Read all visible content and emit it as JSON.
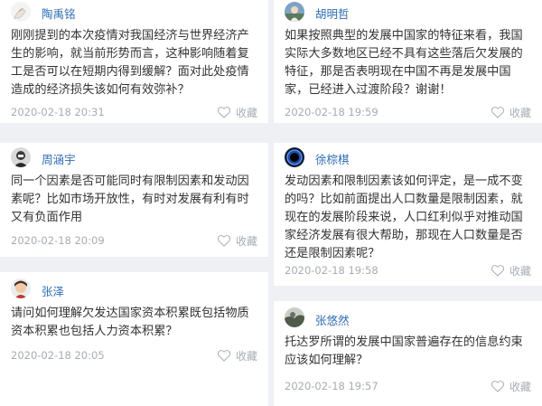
{
  "left_column": [
    {
      "user": "陶禹铭",
      "question": "刚刚提到的本次疫情对我国经济与世界经济产生的影响，就当前形势而言，这种影响随着复工是否可以在短期内得到缓解？面对此处疫情造成的经济损失该如何有效弥补？",
      "date": "2020-02-18 20:31",
      "fav_label": "收藏"
    },
    {
      "user": "周涵宇",
      "question": "同一个因素是否可能同时有限制因素和发动因素呢？比如市场开放性，有时对发展有利有时又有负面作用",
      "date": "2020-02-18 20:09",
      "fav_label": "收藏"
    },
    {
      "user": "张泽",
      "question": "请问如何理解欠发达国家资本积累既包括物质资本积累也包括人力资本积累？",
      "date": "2020-02-18 20:05",
      "fav_label": "收藏"
    }
  ],
  "right_column": [
    {
      "user": "胡明哲",
      "question": "如果按照典型的发展中国家的特征来看，我国实际大多数地区已经不具有这些落后欠发展的特征，那是否表明现在中国不再是发展中国家，已经进入过渡阶段？谢谢！",
      "date": "2020-02-18 19:59",
      "fav_label": "收藏"
    },
    {
      "user": "徐棕棋",
      "question": "发动因素和限制因素该如何评定，是一成不变的吗？比如前面提出人口数量是限制因素，就现在的发展阶段来说，人口红利似乎对推动国家经济发展有很大帮助，那现在人口数量是否还是限制因素呢？",
      "date": "2020-02-18 19:58",
      "fav_label": "收藏"
    },
    {
      "user": "张悠然",
      "question": "托达罗所谓的发展中国家普遍存在的信息约束应该如何理解？",
      "date": "2020-02-18 19:57",
      "fav_label": "收藏"
    }
  ],
  "icons": {
    "favorite": "heart-outline-icon"
  },
  "colors": {
    "username": "#2f6db3",
    "question_text": "#333333",
    "meta_text": "#a7acb3",
    "page_background": "#eef0f3",
    "card_background": "#ffffff"
  }
}
